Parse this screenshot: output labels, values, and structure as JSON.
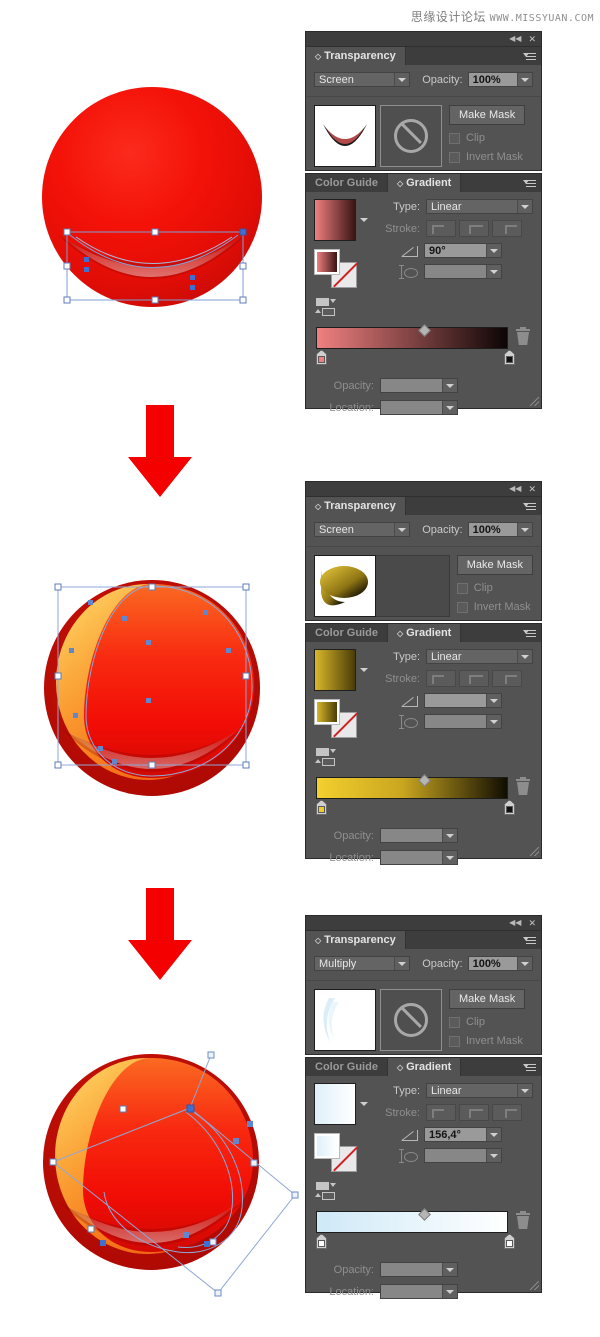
{
  "watermark": {
    "cn": "思缘设计论坛",
    "url": "WWW.MISSYUAN.COM"
  },
  "panels": [
    {
      "id": "step1",
      "transparency": {
        "tab_label": "Transparency",
        "blend_mode": "Screen",
        "opacity_label": "Opacity:",
        "opacity_value": "100%",
        "make_mask_label": "Make Mask",
        "clip_label": "Clip",
        "invert_mask_label": "Invert Mask",
        "mask_icon": "no-mask-icon",
        "thumbnail": "red-crescent-thumbnail",
        "has_mask_box": true
      },
      "gradient": {
        "tab_inactive_label": "Color Guide",
        "tab_active_label": "Gradient",
        "type_label": "Type:",
        "type_value": "Linear",
        "stroke_label": "Stroke:",
        "angle_value": "90°",
        "aspect_value": "",
        "opacity_label": "Opacity:",
        "opacity_value": "",
        "location_label": "Location:",
        "location_value": "",
        "swatch_from": "#ef7f7f",
        "swatch_to": "#3a1414",
        "bar_from": "#f08080",
        "bar_to": "#0d0505",
        "stop_left_color": "#f08080",
        "stop_right_color": "#111111"
      }
    },
    {
      "id": "step2",
      "transparency": {
        "tab_label": "Transparency",
        "blend_mode": "Screen",
        "opacity_label": "Opacity:",
        "opacity_value": "100%",
        "make_mask_label": "Make Mask",
        "clip_label": "Clip",
        "invert_mask_label": "Invert Mask",
        "mask_icon": "no-mask-icon",
        "thumbnail": "gold-ellipse-thumbnail",
        "has_mask_box": false
      },
      "gradient": {
        "tab_inactive_label": "Color Guide",
        "tab_active_label": "Gradient",
        "type_label": "Type:",
        "type_value": "Linear",
        "stroke_label": "Stroke:",
        "angle_value": "",
        "aspect_value": "",
        "opacity_label": "Opacity:",
        "opacity_value": "",
        "location_label": "Location:",
        "location_value": "",
        "swatch_from": "#d9b72a",
        "swatch_to": "#4a3c07",
        "bar_from": "#f3cf2e",
        "bar_to": "#100d02",
        "stop_left_color": "#f0cb2c",
        "stop_right_color": "#111111"
      }
    },
    {
      "id": "step3",
      "transparency": {
        "tab_label": "Transparency",
        "blend_mode": "Multiply",
        "opacity_label": "Opacity:",
        "opacity_value": "100%",
        "make_mask_label": "Make Mask",
        "clip_label": "Clip",
        "invert_mask_label": "Invert Mask",
        "mask_icon": "no-mask-icon",
        "thumbnail": "pale-blue-thumbnail",
        "has_mask_box": true
      },
      "gradient": {
        "tab_inactive_label": "Color Guide",
        "tab_active_label": "Gradient",
        "type_label": "Type:",
        "type_value": "Linear",
        "stroke_label": "Stroke:",
        "angle_value": "156,4°",
        "aspect_value": "",
        "opacity_label": "Opacity:",
        "opacity_value": "",
        "location_label": "Location:",
        "location_value": "",
        "swatch_from": "#dff0fa",
        "swatch_to": "#ffffff",
        "bar_from": "#cfe9f7",
        "bar_to": "#ffffff",
        "stop_left_color": "#ffffff",
        "stop_right_color": "#ffffff"
      }
    }
  ],
  "illustrations": [
    {
      "id": "sphere-1",
      "name": "red-sphere-with-bottom-highlight",
      "selection": "rectangular-bounding-box"
    },
    {
      "id": "sphere-2",
      "name": "red-sphere-with-orange-highlight",
      "selection": "rectangular-bounding-box"
    },
    {
      "id": "sphere-3",
      "name": "red-sphere-with-orange-and-white-highlight",
      "selection": "rotated-bounding-box"
    }
  ],
  "arrows": [
    {
      "id": "arrow-1",
      "name": "down-arrow",
      "color": "#f50000"
    },
    {
      "id": "arrow-2",
      "name": "down-arrow",
      "color": "#f50000"
    }
  ]
}
